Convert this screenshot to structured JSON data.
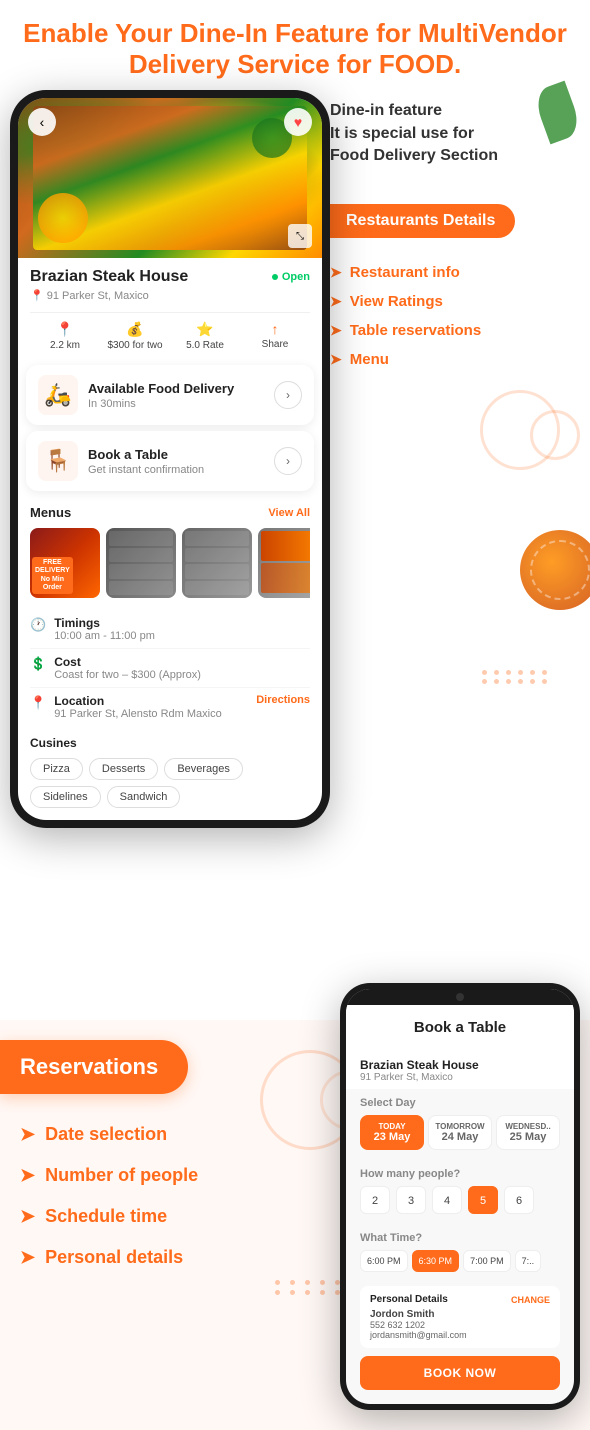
{
  "header": {
    "title": "Enable Your Dine-In Feature for MultiVendor Delivery Service for FOOD."
  },
  "top_section": {
    "dine_in": {
      "title": "Dine-in feature",
      "subtitle1": "It is special use for",
      "subtitle2": "Food Delivery Section"
    },
    "restaurants_badge": "Restaurants Details",
    "features": [
      {
        "label": "Restaurant info"
      },
      {
        "label": "View Ratings"
      },
      {
        "label": "Table reservations"
      },
      {
        "label": "Menu"
      }
    ]
  },
  "phone_left": {
    "back": "‹",
    "restaurant": {
      "name": "Brazian Steak House",
      "address": "91 Parker St, Maxico",
      "status": "Open",
      "stats": [
        {
          "icon": "📍",
          "value": "2.2 km"
        },
        {
          "icon": "💰",
          "value": "$300 for two"
        },
        {
          "icon": "⭐",
          "value": "5.0 Rate"
        },
        {
          "icon": "↑",
          "value": "Share"
        }
      ]
    },
    "delivery_card": {
      "title": "Available Food Delivery",
      "subtitle": "In 30mins"
    },
    "book_card": {
      "title": "Book a Table",
      "subtitle": "Get instant confirmation"
    },
    "menus": {
      "title": "Menus",
      "view_all": "View All"
    },
    "info": [
      {
        "icon": "🕐",
        "title": "Timings",
        "detail": "10:00 am - 11:00 pm"
      },
      {
        "icon": "💲",
        "title": "Cost",
        "detail": "Coast for two – $300 (Approx)"
      },
      {
        "icon": "📍",
        "title": "Location",
        "detail": "91 Parker St, Alensto Rdm Maxico",
        "extra": "Directions"
      }
    ],
    "cuisines": {
      "title": "Cusines",
      "tags": [
        "Pizza",
        "Desserts",
        "Beverages",
        "Sidelines",
        "Sandwich"
      ]
    }
  },
  "bottom_section": {
    "badge": "Reservations",
    "features": [
      {
        "label": "Date selection"
      },
      {
        "label": "Number of people"
      },
      {
        "label": "Schedule time"
      },
      {
        "label": "Personal details"
      }
    ]
  },
  "phone_right": {
    "header": "Book a Table",
    "restaurant_name": "Brazian Steak House",
    "restaurant_addr": "91 Parker St, Maxico",
    "select_day_label": "Select Day",
    "days": [
      {
        "label": "TODAY",
        "num": "23 May",
        "active": true
      },
      {
        "label": "TOMORROW",
        "num": "24 May",
        "active": false
      },
      {
        "label": "WEDNESD..",
        "num": "25 May",
        "active": false
      }
    ],
    "people_label": "How many people?",
    "people": [
      "2",
      "3",
      "4",
      "5",
      "6"
    ],
    "people_active": "5",
    "time_label": "What Time?",
    "times": [
      "6:00 PM",
      "6:30 PM",
      "7:00 PM",
      "7:.."
    ],
    "time_active": "6:30 PM",
    "personal_details": {
      "title": "Personal Details",
      "change": "CHANGE",
      "name": "Jordon Smith",
      "phone": "552 632 1202",
      "email": "jordansmith@gmail.com"
    },
    "book_now": "BOOK NOW"
  }
}
